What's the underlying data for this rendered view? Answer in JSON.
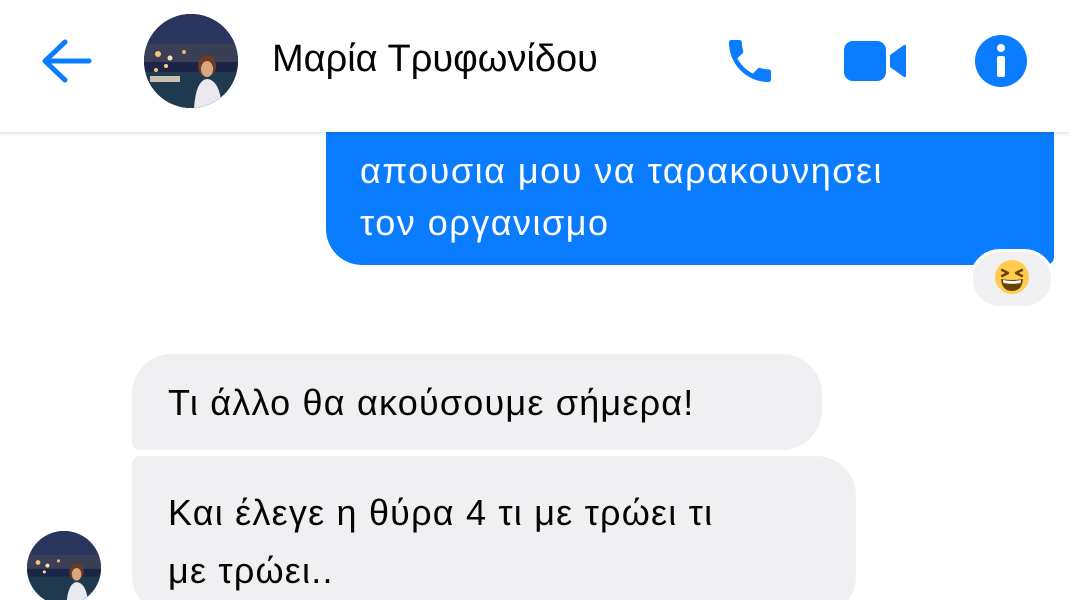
{
  "header": {
    "contact_name": "Μαρία Τρυφωνίδου",
    "icons": [
      "back-arrow-icon",
      "phone-icon",
      "video-camera-icon",
      "info-icon"
    ]
  },
  "messages": {
    "outgoing": {
      "lines": [
        "απουσια μου να ταρακουνησει",
        "τον οργανισμο"
      ],
      "reaction": "😆"
    },
    "incoming": [
      {
        "lines": [
          "Τι άλλο θα ακούσουμε σήμερα!"
        ]
      },
      {
        "lines": [
          "Και έλεγε η θύρα 4 τι με τρώει τι",
          "με τρώει.."
        ]
      }
    ]
  },
  "colors": {
    "accent": "#0a7cff",
    "incoming_bubble": "#f0f0f2",
    "text": "#050505"
  }
}
